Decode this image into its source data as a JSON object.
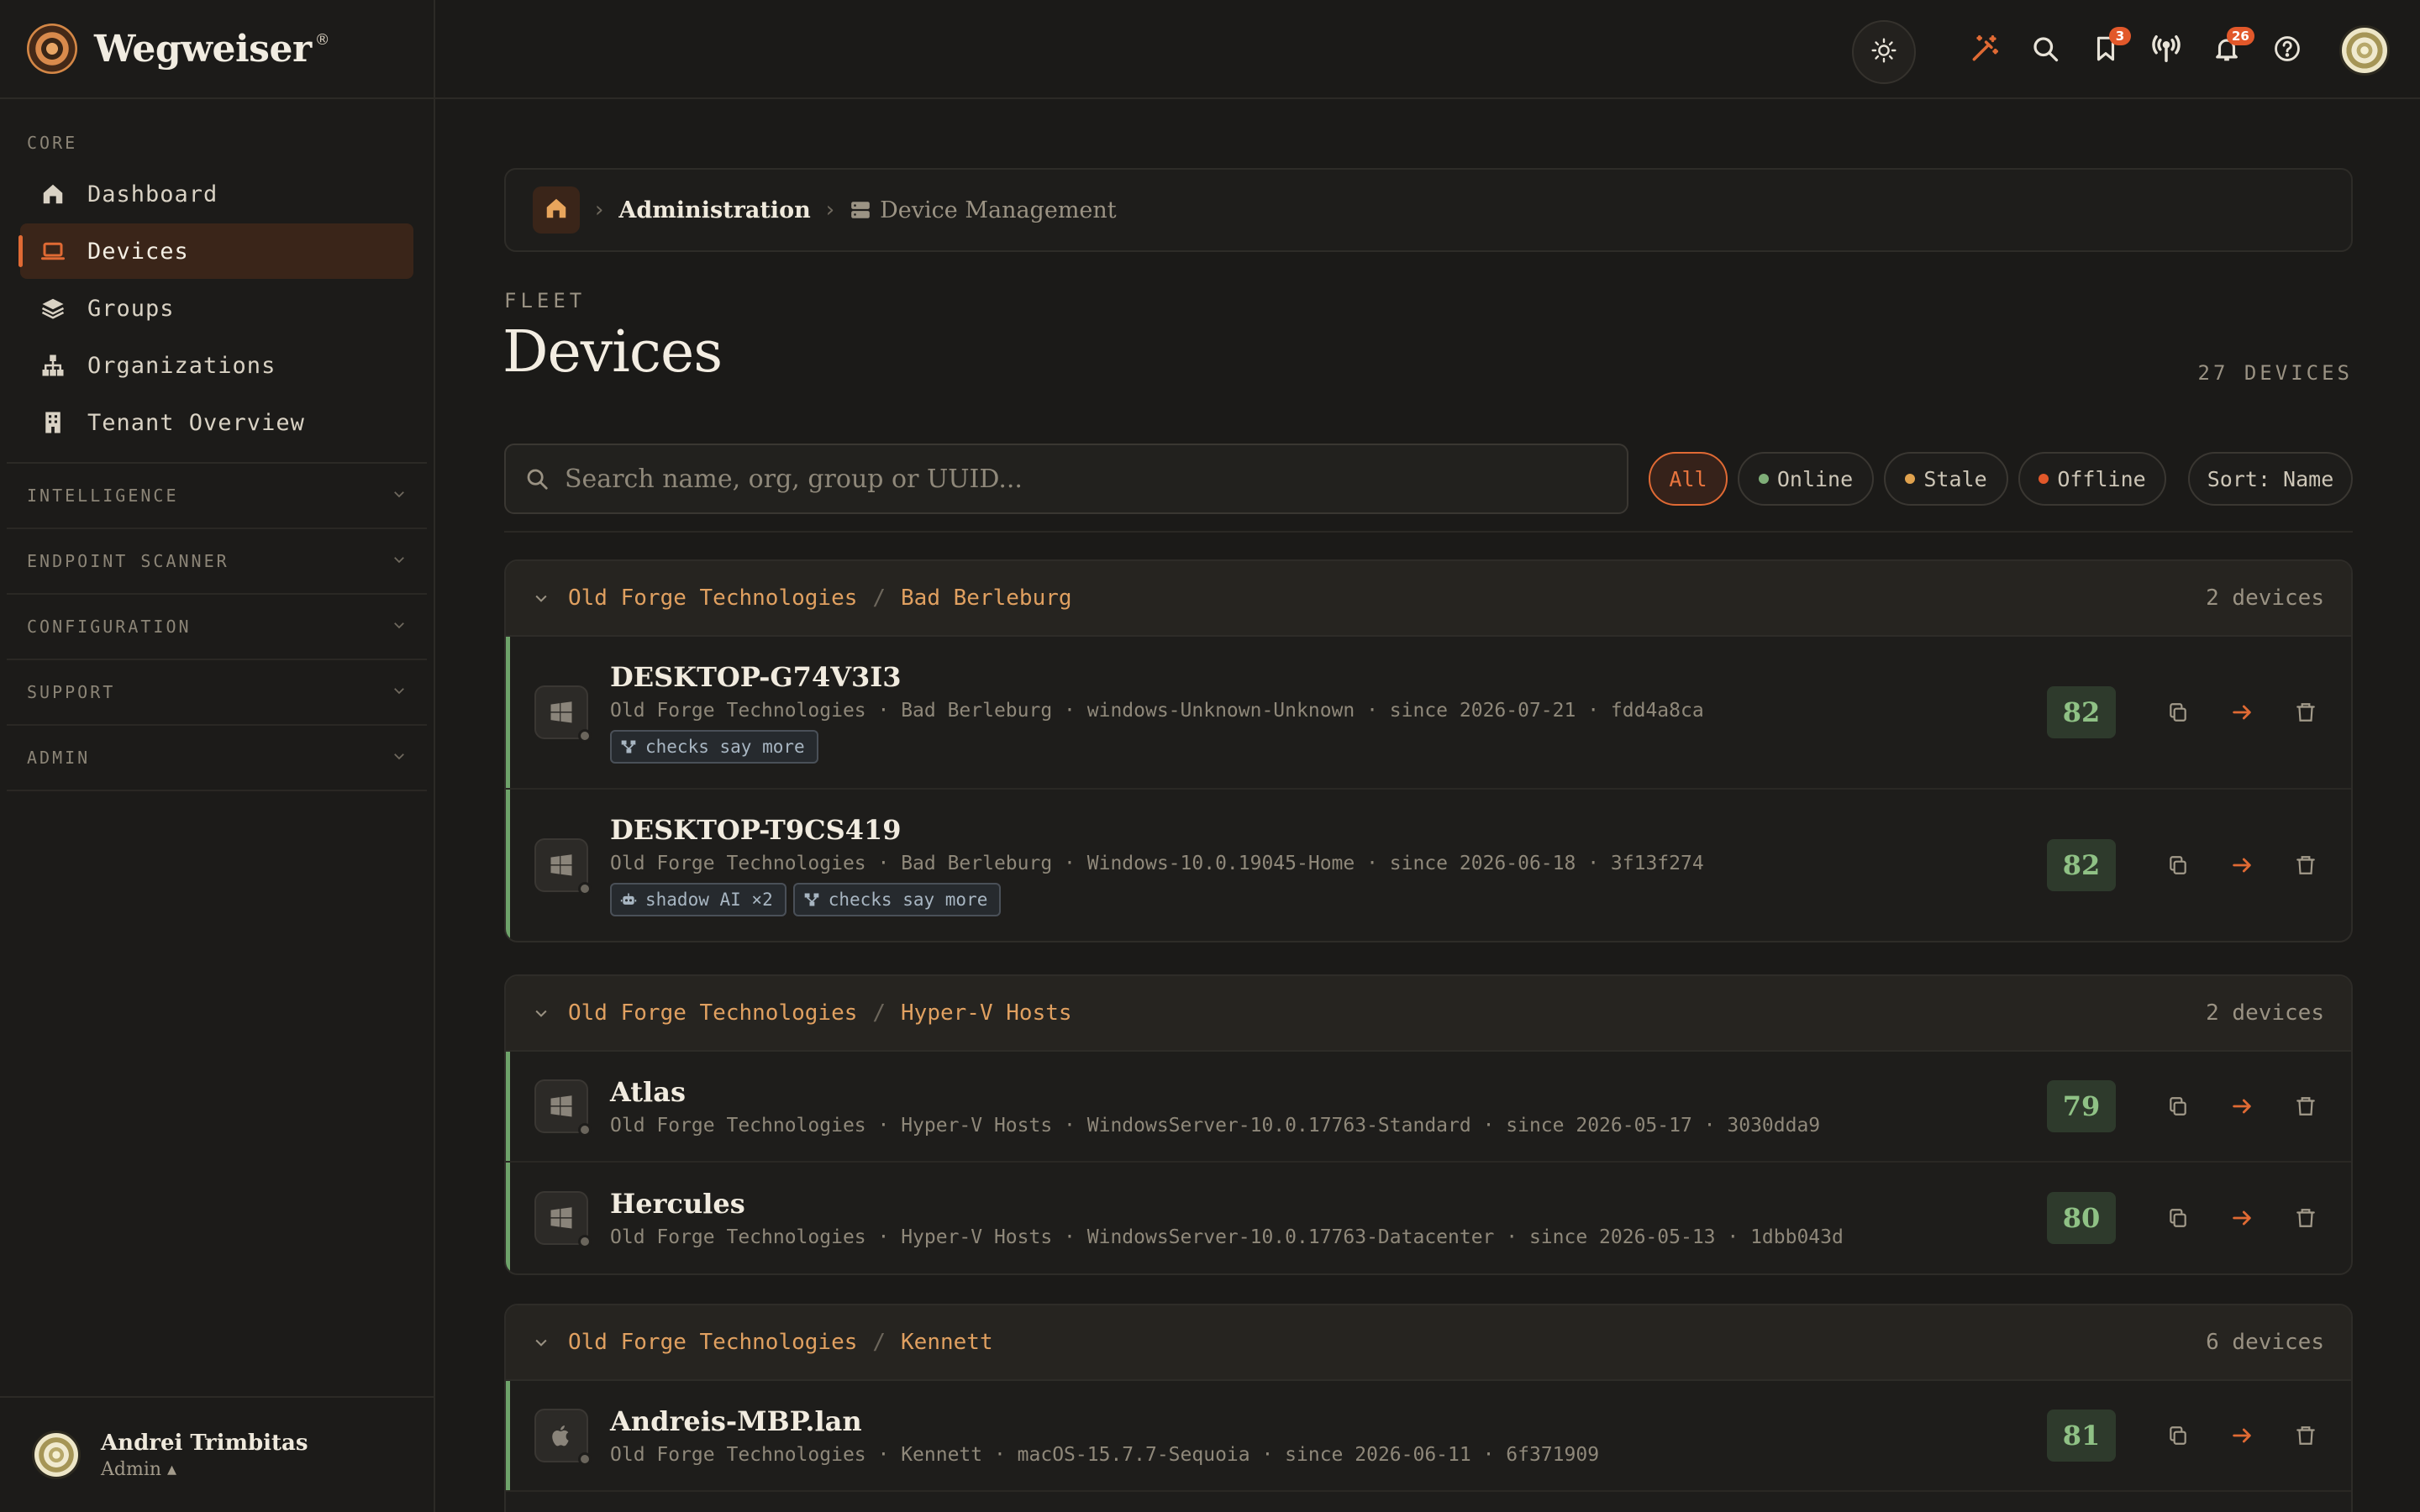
{
  "brand": {
    "name": "Wegweiser",
    "reg": "®"
  },
  "sidebar": {
    "section_label": "CORE",
    "items": [
      {
        "label": "Dashboard",
        "icon": "home-icon"
      },
      {
        "label": "Devices",
        "icon": "laptop-icon",
        "active": true
      },
      {
        "label": "Groups",
        "icon": "layers-icon"
      },
      {
        "label": "Organizations",
        "icon": "org-tree-icon"
      },
      {
        "label": "Tenant Overview",
        "icon": "building-icon"
      }
    ],
    "collapsed_sections": [
      "INTELLIGENCE",
      "ENDPOINT SCANNER",
      "CONFIGURATION",
      "SUPPORT",
      "ADMIN"
    ],
    "user": {
      "name": "Andrei Trimbitas",
      "role": "Admin ▴"
    }
  },
  "topbar": {
    "bookmark_badge": "3",
    "notification_badge": "26"
  },
  "breadcrumb": {
    "parent": "Administration",
    "current": "Device Management"
  },
  "page": {
    "eyebrow": "FLEET",
    "title": "Devices",
    "count": "27 DEVICES"
  },
  "search": {
    "placeholder": "Search name, org, group or UUID..."
  },
  "filters": {
    "all": "All",
    "online": "Online",
    "stale": "Stale",
    "offline": "Offline",
    "sort": "Sort: Name"
  },
  "colors": {
    "accent": "#e06a34",
    "online": "#7fae78",
    "stale": "#e0a24e",
    "offline": "#e2582a",
    "score_text": "#8fc185"
  },
  "groups": [
    {
      "org": "Old Forge Technologies",
      "group": "Bad Berleburg",
      "count": "2 devices",
      "devices": [
        {
          "name": "DESKTOP-G74V3I3",
          "org": "Old Forge Technologies",
          "group": "Bad Berleburg",
          "os": "windows-Unknown-Unknown",
          "since": "since 2026-07-21",
          "id": "fdd4a8ca",
          "score": "82",
          "tags": [
            "checks say more"
          ]
        },
        {
          "name": "DESKTOP-T9CS419",
          "org": "Old Forge Technologies",
          "group": "Bad Berleburg",
          "os": "Windows-10.0.19045-Home",
          "since": "since 2026-06-18",
          "id": "3f13f274",
          "score": "82",
          "tags": [
            "shadow AI ×2",
            "checks say more"
          ]
        }
      ]
    },
    {
      "org": "Old Forge Technologies",
      "group": "Hyper-V Hosts",
      "count": "2 devices",
      "devices": [
        {
          "name": "Atlas",
          "org": "Old Forge Technologies",
          "group": "Hyper-V Hosts",
          "os": "WindowsServer-10.0.17763-Standard",
          "since": "since 2026-05-17",
          "id": "3030dda9",
          "score": "79"
        },
        {
          "name": "Hercules",
          "org": "Old Forge Technologies",
          "group": "Hyper-V Hosts",
          "os": "WindowsServer-10.0.17763-Datacenter",
          "since": "since 2026-05-13",
          "id": "1dbb043d",
          "score": "80"
        }
      ]
    },
    {
      "org": "Old Forge Technologies",
      "group": "Kennett",
      "count": "6 devices",
      "devices": [
        {
          "name": "Andreis-MBP.lan",
          "org": "Old Forge Technologies",
          "group": "Kennett",
          "os": "macOS-15.7.7-Sequoia",
          "since": "since 2026-06-11",
          "id": "6f371909",
          "score": "81"
        }
      ]
    }
  ],
  "meta_separator": " · "
}
